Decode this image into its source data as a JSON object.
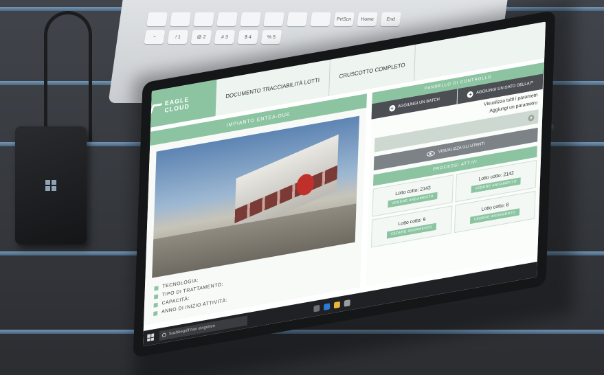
{
  "scene": {
    "description_colors": {
      "accent": "#8cc4a2",
      "dark_button": "#4b4f54",
      "desk": "#3a3c40"
    }
  },
  "keyboard": {
    "keys_row1": [
      "",
      "",
      "",
      "",
      "",
      "",
      "",
      "",
      "PrtScn",
      "Home",
      "End"
    ],
    "keys_row2": [
      "~",
      "! 1",
      "@ 2",
      "# 3",
      "$ 4",
      "% 5"
    ]
  },
  "app": {
    "brand": "EAGLE CLOUD",
    "nav": [
      "DOCUMENTO TRACCIABILITÀ LOTTI",
      "CRUSCOTTO COMPLETO"
    ]
  },
  "left_pane": {
    "header": "IMPIANTO ENTEA-DUE",
    "info": [
      "TECNOLOGIA:",
      "TIPO DI TRATTAMENTO:",
      "CAPACITÀ:",
      "ANNO DI INIZIO ATTIVITÀ:"
    ]
  },
  "right_pane": {
    "panel_header": "PANNELLO DI CONTROLLO",
    "add_batch": "AGGIUNGI UN BATCH",
    "add_data": "AGGIUNGI UN DATO DELLA P",
    "view_all_params": "Visualizza tutti i parametri",
    "add_param": "Aggiungi un parametro",
    "view_users": "VISUALIZZA GLI UTENTI",
    "active_header": "PROCESSI ATTIVI",
    "lots": [
      {
        "title": "Lotto cotto: 2143",
        "button": "VEDERE ANDAMENTO"
      },
      {
        "title": "Lotto cotto: 2142",
        "button": "VEDERE ANDAMENTO"
      },
      {
        "title": "Lotto cotto: 9",
        "button": "VEDERE ANDAMENTO"
      },
      {
        "title": "Lotto cotto: 8",
        "button": "VEDERE ANDAMENTO"
      }
    ]
  },
  "taskbar": {
    "search_placeholder": "Suchbegriff hier eingeben"
  }
}
